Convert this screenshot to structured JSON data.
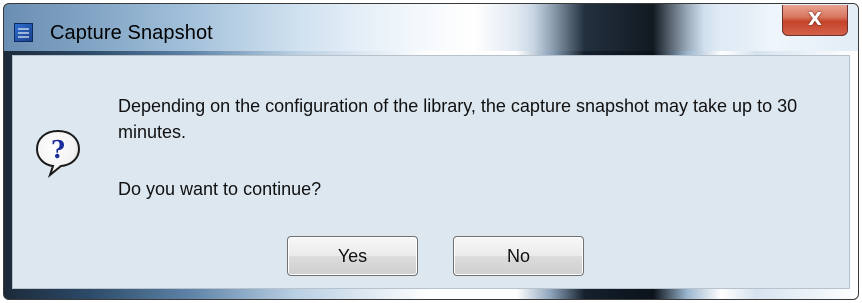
{
  "window": {
    "title": "Capture Snapshot",
    "close_label": "X",
    "icon": "app-icon"
  },
  "dialog": {
    "icon": "question-icon",
    "message": "Depending on the configuration of the library, the capture snapshot may take up to 30 minutes.",
    "question": "Do you want to continue?",
    "buttons": {
      "yes_label": "Yes",
      "no_label": "No"
    }
  },
  "colors": {
    "dialog_background": "#dde7f0",
    "close_button": "#c5442a",
    "question_icon": "#1b2d9b"
  }
}
